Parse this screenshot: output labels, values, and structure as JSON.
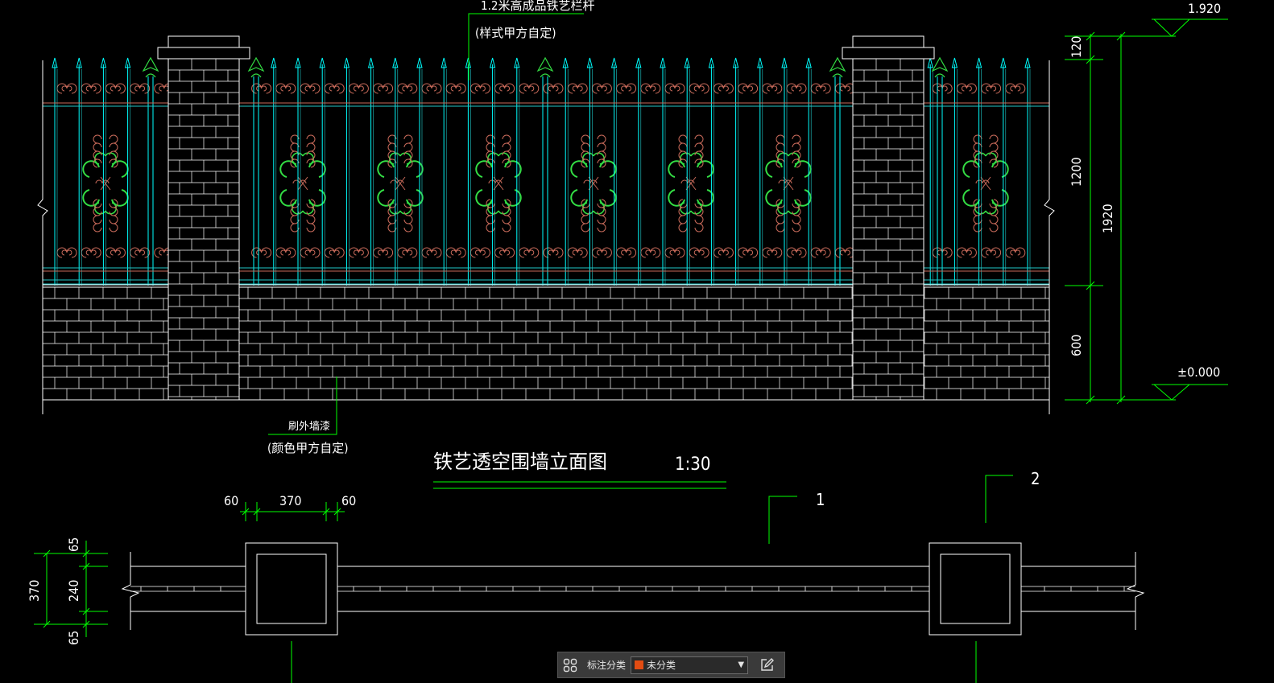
{
  "drawing": {
    "title": "铁艺透空围墙立面图",
    "scale": "1:30",
    "callout_top": "1.2米高成品铁艺栏杆",
    "callout_top_note": "(样式甲方自定)",
    "callout_bottom": "刷外墙漆",
    "callout_bottom_note": "(颜色甲方自定)",
    "section_marks": [
      "1",
      "2"
    ],
    "elevation_labels": [
      "1.920",
      "±0.000"
    ],
    "dims_vertical_right": [
      "120",
      "1200",
      "600",
      "1920"
    ],
    "dims_plan_top": [
      "60",
      "370",
      "60"
    ],
    "dims_plan_left": [
      "65",
      "240",
      "65",
      "370"
    ],
    "colors": {
      "background": "#000000",
      "brick": "#ffffff",
      "rails": "#20c8c8",
      "bars": "#00ffff",
      "ornament_red": "#c86a5a",
      "ornament_green": "#33dd44",
      "dimension": "#00ff00",
      "text": "#ffffff"
    }
  },
  "toolbar": {
    "grid_icon": "grid-icon",
    "label": "标注分类",
    "selected": "未分类",
    "swatch_color": "#e24c12",
    "edit_icon": "edit-icon"
  }
}
